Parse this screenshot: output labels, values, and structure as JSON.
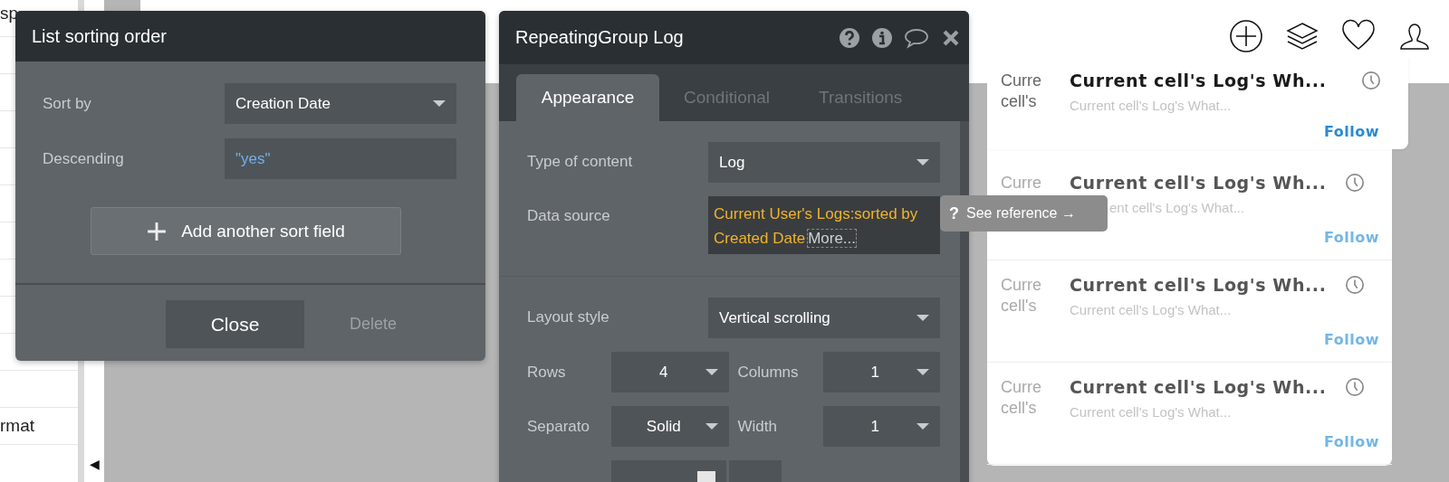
{
  "sidebar": {
    "top_label": "sp",
    "bottom_label": "rmat",
    "collapse_glyph": "◀"
  },
  "sort_dialog": {
    "title": "List sorting order",
    "fields": [
      {
        "label": "Sort by",
        "kind": "dropdown",
        "value": "Creation Date"
      },
      {
        "label": "Descending",
        "kind": "expression",
        "value": "\"yes\""
      }
    ],
    "add_button": "Add another sort field",
    "close_button": "Close",
    "delete_button": {
      "label": "Delete",
      "disabled": true
    }
  },
  "property_editor": {
    "title": "RepeatingGroup Log",
    "tabs": [
      {
        "label": "Appearance",
        "selected": true
      },
      {
        "label": "Conditional",
        "selected": false
      },
      {
        "label": "Transitions",
        "selected": false
      }
    ],
    "fields": [
      {
        "label": "Type of content",
        "kind": "dropdown",
        "value": "Log"
      },
      {
        "label": "Data source",
        "kind": "expression",
        "value": "Current User's Logs:sorted by Created Date",
        "more_link": "More..."
      }
    ],
    "layout_style": {
      "label": "Layout style",
      "value": "Vertical scrolling"
    },
    "pair_rows": [
      [
        {
          "label": "Rows",
          "value": "4"
        },
        {
          "label": "Columns",
          "value": "1"
        }
      ],
      [
        {
          "label": "Separato",
          "value": "Solid"
        },
        {
          "label": "Width",
          "value": "1"
        }
      ]
    ]
  },
  "tooltip": {
    "icon_text": "?",
    "label": "See reference →"
  },
  "preview_list": {
    "rows": [
      {
        "thumb_lines": [
          "Curre",
          "cell's"
        ],
        "title": "Current cell's Log's Wh...",
        "subtitle": "Current cell's Log's What...",
        "follow": "Follow",
        "selected": true
      },
      {
        "thumb_lines": [
          "Curre"
        ],
        "title": "Current cell's Log's Wh...",
        "subtitle": "ent cell's Log's What...",
        "follow": "Follow",
        "selected": false
      },
      {
        "thumb_lines": [
          "Curre",
          "cell's"
        ],
        "title": "Current cell's Log's Wh...",
        "subtitle": "Current cell's Log's What...",
        "follow": "Follow",
        "selected": false
      },
      {
        "thumb_lines": [
          "Curre",
          "cell's"
        ],
        "title": "Current cell's Log's Wh...",
        "subtitle": "Current cell's Log's What...",
        "follow": "Follow",
        "selected": false
      }
    ]
  }
}
